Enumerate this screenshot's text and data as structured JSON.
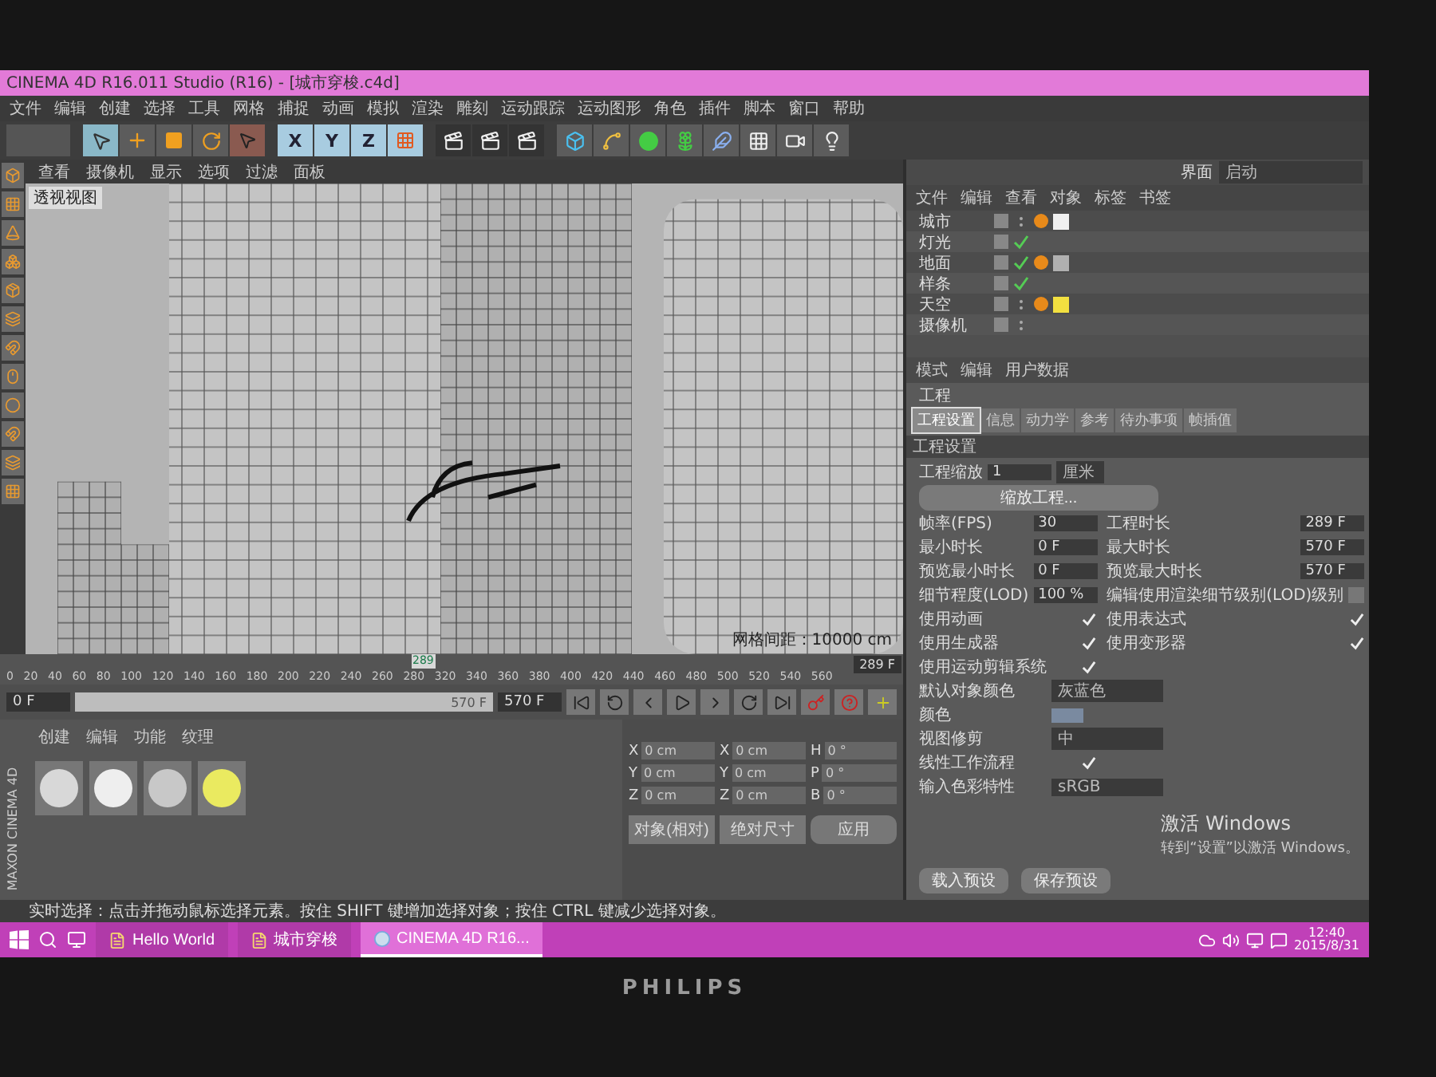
{
  "window": {
    "title": "CINEMA 4D R16.011 Studio (R16) - [城市穿梭.c4d]"
  },
  "menu": [
    "文件",
    "编辑",
    "创建",
    "选择",
    "工具",
    "网格",
    "捕捉",
    "动画",
    "模拟",
    "渲染",
    "雕刻",
    "运动跟踪",
    "运动图形",
    "角色",
    "插件",
    "脚本",
    "窗口",
    "帮助"
  ],
  "toolbar": {
    "axis_buttons": [
      "X",
      "Y",
      "Z"
    ]
  },
  "viewport": {
    "menu": [
      "查看",
      "摄像机",
      "显示",
      "选项",
      "过滤",
      "面板"
    ],
    "label": "透视视图",
    "grid_spacing": "网格间距：10000 cm"
  },
  "object_manager": {
    "layout_label": "界面",
    "layout_value": "启动",
    "menu": [
      "文件",
      "编辑",
      "查看",
      "对象",
      "标签",
      "书签"
    ],
    "objects": [
      {
        "name": "城市",
        "enabled": false,
        "color": "#f0f0f0"
      },
      {
        "name": "灯光",
        "enabled": true
      },
      {
        "name": "地面",
        "enabled": true,
        "color": "#b0b0b0"
      },
      {
        "name": "样条",
        "enabled": true
      },
      {
        "name": "天空",
        "enabled": false,
        "color": "#f2e040"
      },
      {
        "name": "摄像机",
        "enabled": false
      }
    ]
  },
  "attributes": {
    "menu": [
      "模式",
      "编辑",
      "用户数据"
    ],
    "object_title": "工程",
    "tabs": [
      {
        "label": "工程设置",
        "selected": true
      },
      {
        "label": "信息",
        "selected": false
      },
      {
        "label": "动力学",
        "selected": false
      },
      {
        "label": "参考",
        "selected": false
      },
      {
        "label": "待办事项",
        "selected": false
      },
      {
        "label": "帧插值",
        "selected": false
      }
    ],
    "section": "工程设置",
    "rows": [
      {
        "kind": "scale",
        "label": "工程缩放",
        "value": "1",
        "unit": "厘米"
      },
      {
        "kind": "button",
        "label": "缩放工程..."
      },
      {
        "kind": "number",
        "label": "帧率(FPS)",
        "value": "30"
      },
      {
        "kind": "number",
        "label": "工程时长",
        "value": "289 F"
      },
      {
        "kind": "number",
        "label": "最小时长",
        "value": "0 F"
      },
      {
        "kind": "number",
        "label": "最大时长",
        "value": "570 F"
      },
      {
        "kind": "number",
        "label": "预览最小时长",
        "value": "0 F"
      },
      {
        "kind": "number",
        "label": "预览最大时长",
        "value": "570 F"
      },
      {
        "kind": "number",
        "label": "细节程度(LOD)",
        "value": "100 %"
      },
      {
        "kind": "check",
        "label": "编辑使用渲染细节级别(LOD)级别",
        "checked": false
      },
      {
        "kind": "check",
        "label": "使用动画",
        "checked": true
      },
      {
        "kind": "check",
        "label": "使用表达式",
        "checked": true
      },
      {
        "kind": "check",
        "label": "使用生成器",
        "checked": true
      },
      {
        "kind": "check",
        "label": "使用变形器",
        "checked": true
      },
      {
        "kind": "check",
        "label": "使用运动剪辑系统",
        "checked": true
      },
      {
        "kind": "dropdown",
        "label": "默认对象颜色",
        "value": "灰蓝色"
      },
      {
        "kind": "color",
        "label": "颜色"
      },
      {
        "kind": "dropdown",
        "label": "视图修剪",
        "value": "中"
      },
      {
        "kind": "check",
        "label": "线性工作流程",
        "checked": true
      },
      {
        "kind": "dropdown",
        "label": "输入色彩特性",
        "value": "sRGB"
      }
    ],
    "buttons": [
      "载入预设",
      "保存预设"
    ]
  },
  "activation": {
    "title": "激活 Windows",
    "text": "转到“设置”以激活 Windows。"
  },
  "timeline": {
    "ticks": [
      "0",
      "20",
      "40",
      "60",
      "80",
      "100",
      "120",
      "140",
      "160",
      "180",
      "200",
      "220",
      "240",
      "260",
      "280",
      "320",
      "340",
      "360",
      "380",
      "400",
      "420",
      "440",
      "460",
      "480",
      "500",
      "520",
      "540",
      "560"
    ],
    "current": "289",
    "level": 0.507,
    "end_field": "289 F",
    "start_field": "0 F",
    "preview_range": {
      "level": 1,
      "end_label": "570 F"
    },
    "max_field": "570 F"
  },
  "materials": {
    "menu": [
      "创建",
      "编辑",
      "功能",
      "纹理"
    ],
    "items": [
      {
        "color": "#d8d8d8"
      },
      {
        "color": "#eeeeee"
      },
      {
        "color": "#c8c8c8"
      },
      {
        "color": "#eaea60"
      }
    ]
  },
  "brand": "MAXON CINEMA 4D",
  "coordinates": {
    "rows": [
      {
        "axis": "X",
        "position": "0 cm",
        "size_axis": "X",
        "size": "0 cm",
        "rot_axis": "H",
        "rotation": "0 °"
      },
      {
        "axis": "Y",
        "position": "0 cm",
        "size_axis": "Y",
        "size": "0 cm",
        "rot_axis": "P",
        "rotation": "0 °"
      },
      {
        "axis": "Z",
        "position": "0 cm",
        "size_axis": "Z",
        "size": "0 cm",
        "rot_axis": "B",
        "rotation": "0 °"
      }
    ],
    "mode": "对象(相对)",
    "size_mode": "绝对尺寸",
    "apply": "应用"
  },
  "status_bar": "实时选择：点击并拖动鼠标选择元素。按住 SHIFT 键增加选择对象；按住 CTRL 键减少选择对象。",
  "taskbar": {
    "apps": [
      {
        "label": "Hello World",
        "kind": "document",
        "selected": false
      },
      {
        "label": "城市穿梭",
        "kind": "document",
        "selected": false
      },
      {
        "label": "CINEMA 4D R16...",
        "kind": "c4d",
        "selected": true
      }
    ],
    "time": "12:40",
    "date": "2015/8/31"
  },
  "monitor": {
    "brand": "PHILIPS"
  }
}
